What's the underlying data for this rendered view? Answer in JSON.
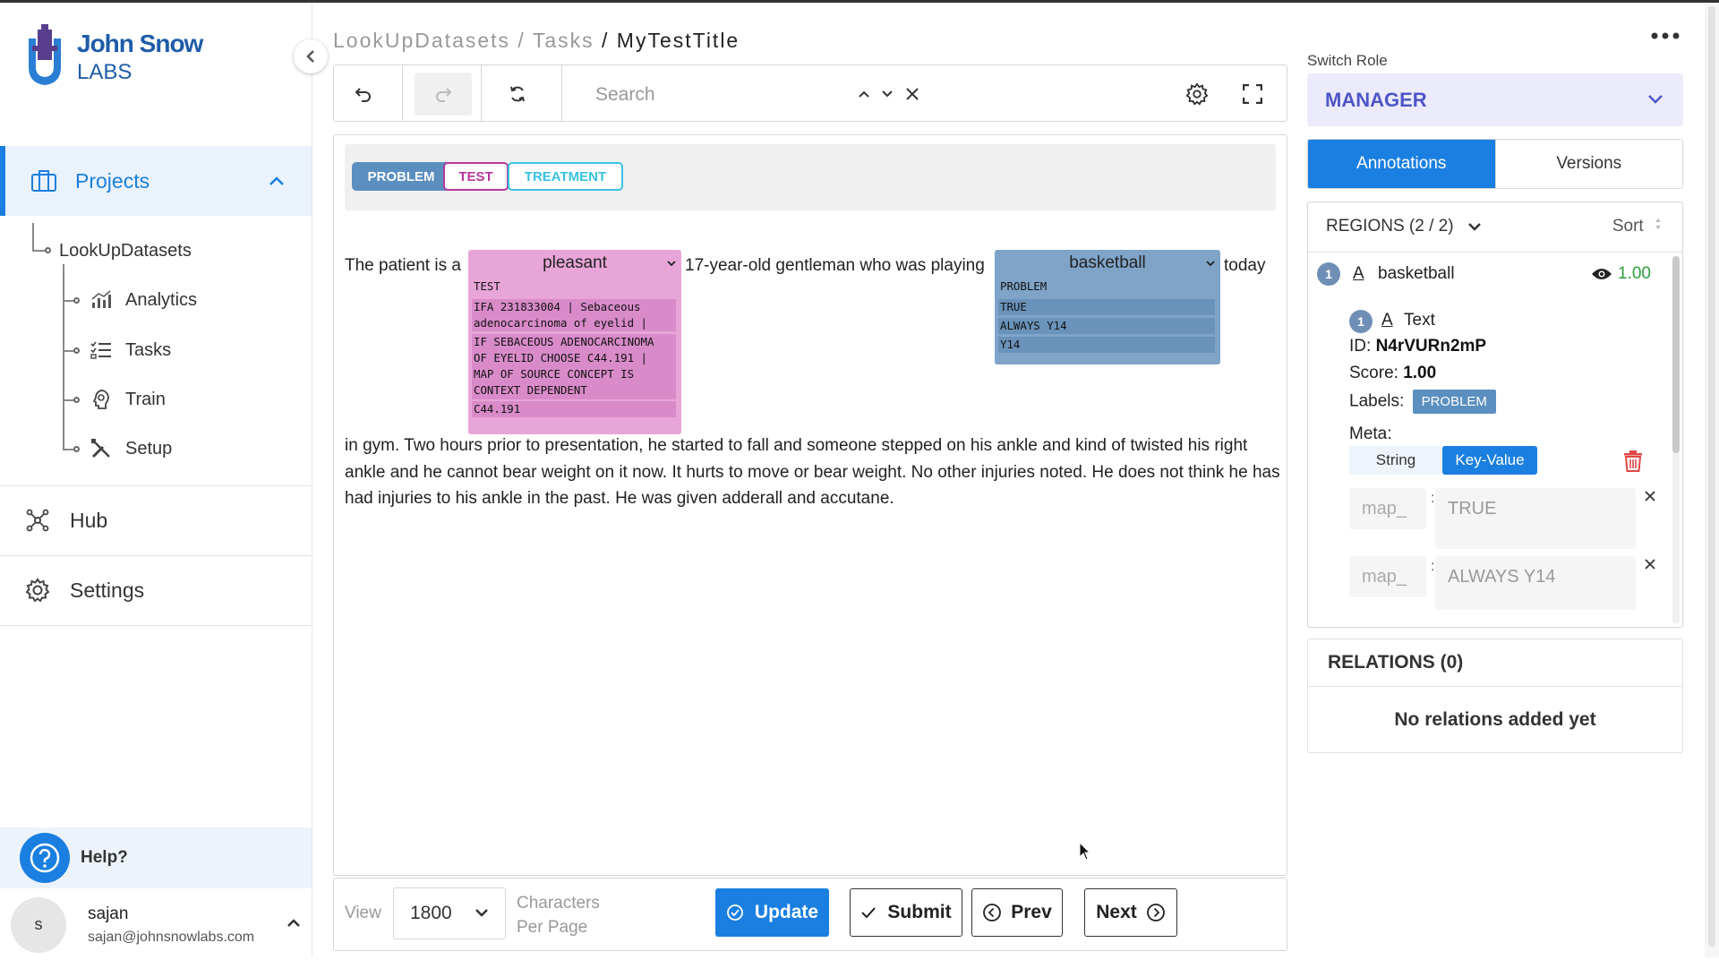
{
  "brand": {
    "line1": "John Snow",
    "line2": "LABS"
  },
  "sidebar": {
    "projects_label": "Projects",
    "tree_root": "LookUpDatasets",
    "tree_items": [
      {
        "label": "Analytics",
        "icon": "analytics-icon"
      },
      {
        "label": "Tasks",
        "icon": "tasks-icon"
      },
      {
        "label": "Train",
        "icon": "train-icon"
      },
      {
        "label": "Setup",
        "icon": "setup-icon"
      }
    ],
    "hub_label": "Hub",
    "settings_label": "Settings",
    "help_label": "Help?",
    "user": {
      "initial": "s",
      "name": "sajan",
      "email": "sajan@johnsnowlabs.com"
    }
  },
  "breadcrumb": {
    "part1": "LookUpDatasets",
    "sep1": " / ",
    "part2": "Tasks",
    "sep2": " / ",
    "current": "MyTestTitle"
  },
  "toolbar": {
    "search_placeholder": "Search"
  },
  "labels": [
    {
      "text": "PROBLEM",
      "color": "#5b8fbf"
    },
    {
      "text": "TEST",
      "color": "#b5379c"
    },
    {
      "text": "TREATMENT",
      "color": "#39c2e0"
    }
  ],
  "text": {
    "seg1": "The patient is a",
    "seg2": "17-year-old gentleman who was playing",
    "seg3": "today",
    "para": "in gym. Two hours prior to presentation, he started to fall and someone stepped on his ankle and kind of twisted his right ankle and he cannot bear weight on it now. It hurts to move or bear weight. No other injuries noted. He does not think he has had injuries to his ankle in the past. He was given adderall and accutane."
  },
  "annotations": {
    "pleasant": {
      "word": "pleasant",
      "rows": [
        "TEST",
        "IFA 231833004 | Sebaceous\nadenocarcinoma of eyelid |",
        "IF SEBACEOUS ADENOCARCINOMA\nOF EYELID CHOOSE C44.191 |\nMAP OF SOURCE CONCEPT IS\nCONTEXT DEPENDENT",
        "C44.191"
      ]
    },
    "basketball": {
      "word": "basketball",
      "rows": [
        "PROBLEM",
        "TRUE",
        "ALWAYS Y14",
        "Y14"
      ]
    }
  },
  "footer": {
    "view_label": "View",
    "per_page_value": "1800",
    "cpp_line1": "Characters",
    "cpp_line2": "Per Page",
    "update_label": "Update",
    "submit_label": "Submit",
    "prev_label": "Prev",
    "next_label": "Next"
  },
  "right": {
    "role_label": "Switch Role",
    "role_value": "MANAGER",
    "tab_annotations": "Annotations",
    "tab_versions": "Versions",
    "regions_title": "REGIONS (2 / 2)",
    "sort_label": "Sort",
    "region": {
      "index": "1",
      "name": "basketball",
      "score": "1.00",
      "sub_index": "1",
      "sub_type": "Text",
      "id_label": "ID:",
      "id_value": "N4rVURn2mP",
      "score_label": "Score:",
      "score_value": "1.00",
      "labels_label": "Labels:",
      "label_chip": "PROBLEM",
      "meta_label": "Meta:",
      "meta_tab_string": "String",
      "meta_tab_kv": "Key-Value",
      "kv": [
        {
          "key": "map_",
          "value": "TRUE"
        },
        {
          "key": "map_",
          "value": "ALWAYS Y14"
        }
      ]
    },
    "relations_title": "RELATIONS (0)",
    "relations_empty": "No relations added yet"
  }
}
